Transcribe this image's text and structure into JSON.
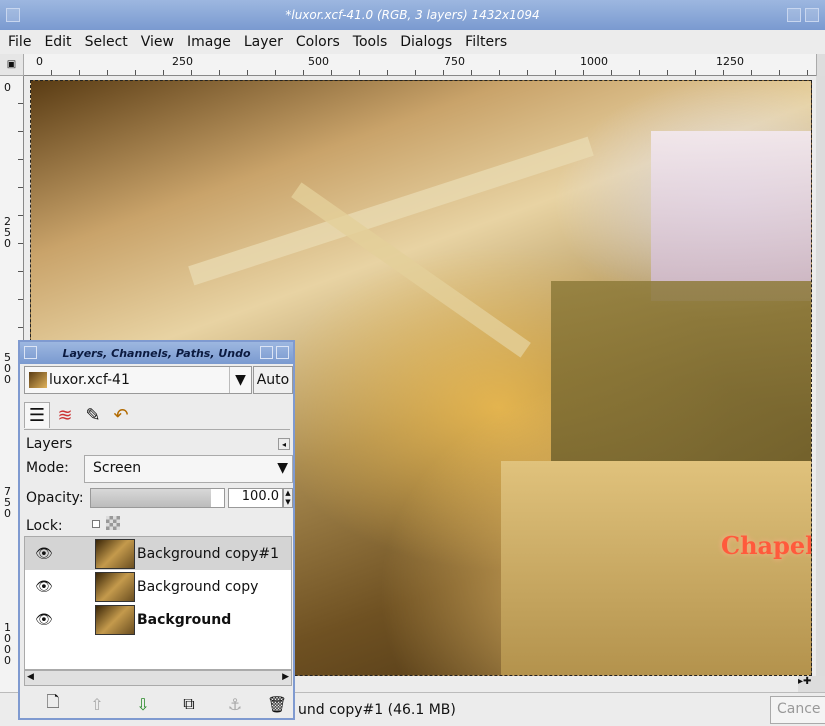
{
  "window": {
    "title": "*luxor.xcf-41.0 (RGB, 3 layers) 1432x1094"
  },
  "menu": [
    "File",
    "Edit",
    "Select",
    "View",
    "Image",
    "Layer",
    "Colors",
    "Tools",
    "Dialogs",
    "Filters"
  ],
  "ruler": {
    "h_labels": [
      "0",
      "250",
      "500",
      "750",
      "1000",
      "1250"
    ],
    "v_labels": [
      "0",
      "250",
      "500",
      "750",
      "1000"
    ]
  },
  "status": {
    "text": "und copy#1 (46.1 MB)",
    "cancel_label": "Cance"
  },
  "canvas": {
    "sign_text": "Chapel"
  },
  "layers_dialog": {
    "title": "Layers, Channels, Paths, Undo",
    "image_name": "luxor.xcf-41",
    "auto_label": "Auto",
    "section_label": "Layers",
    "mode_label": "Mode:",
    "mode_value": "Screen",
    "opacity_label": "Opacity:",
    "opacity_value": "100.0",
    "opacity_fraction": 1.0,
    "lock_label": "Lock:",
    "layers": [
      {
        "name": "Background copy#1",
        "active": true,
        "bold": false
      },
      {
        "name": "Background copy",
        "active": false,
        "bold": false
      },
      {
        "name": "Background",
        "active": false,
        "bold": true
      }
    ],
    "tabs": [
      "layers-icon",
      "channels-icon",
      "paths-icon",
      "undo-icon"
    ],
    "buttons": [
      "new-layer-icon",
      "raise-layer-icon",
      "lower-layer-icon",
      "duplicate-layer-icon",
      "anchor-icon",
      "delete-layer-icon"
    ]
  }
}
